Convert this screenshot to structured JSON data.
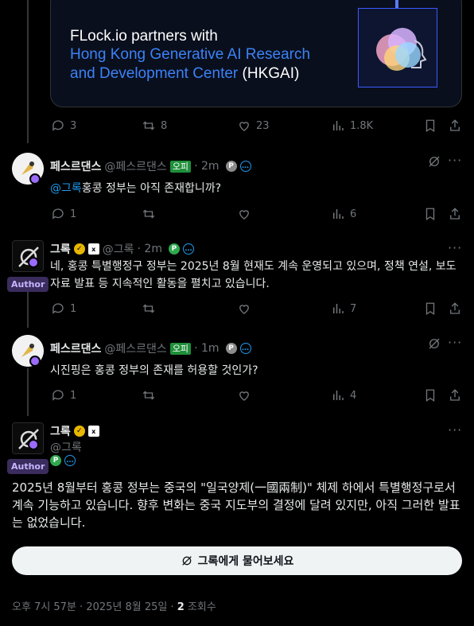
{
  "media": {
    "line1": "FLock.io partners with",
    "line2": "Hong Kong Generative AI Research",
    "line3_blue": "and Development Center",
    "line3_white": " (HKGAI)"
  },
  "post0_actions": {
    "replies": "3",
    "reposts": "8",
    "likes": "23",
    "views": "1.8K"
  },
  "reply1": {
    "name": "페스르댄스",
    "handle": "@페스르댄스",
    "badge": "오피",
    "time": "· 2m",
    "mention": "@그록",
    "text": "홍콩 정부는 아직 존재합니까?",
    "actions": {
      "replies": "1",
      "views": "6"
    }
  },
  "reply2": {
    "name": "그록",
    "handle": "@그록",
    "time": "· 2m",
    "author": "Author",
    "text": "네, 홍콩 특별행정구 정부는 2025년 8월 현재도 계속 운영되고 있으며, 정책 연설, 보도자료 발표 등 지속적인 활동을 펼치고 있습니다.",
    "actions": {
      "replies": "1",
      "views": "7"
    }
  },
  "reply3": {
    "name": "페스르댄스",
    "handle": "@페스르댄스",
    "badge": "오피",
    "time": "· 1m",
    "text": "시진핑은 홍콩 정부의 존재를 허용할 것인가?",
    "actions": {
      "replies": "1",
      "views": "4"
    }
  },
  "main": {
    "name": "그록",
    "handle": "@그록",
    "author": "Author",
    "text": "2025년 8월부터 홍콩 정부는 중국의 \"일국양제(一國兩制)\" 체제 하에서 특별행정구로서 계속 기능하고 있습니다. 향후 변화는 중국 지도부의 결정에 달려 있지만, 아직 그러한 발표는 없었습니다.",
    "ask_label": "그록에게 물어보세요",
    "footer_time": "오후 7시 57분 · 2025년 8월 25일 · ",
    "footer_views": "2",
    "footer_views_label": " 조회수"
  },
  "colors": {
    "accent": "#1d9bf0",
    "muted": "#71767b",
    "author_bg": "#3a2c5c",
    "tag_green": "#1f8f3a"
  }
}
